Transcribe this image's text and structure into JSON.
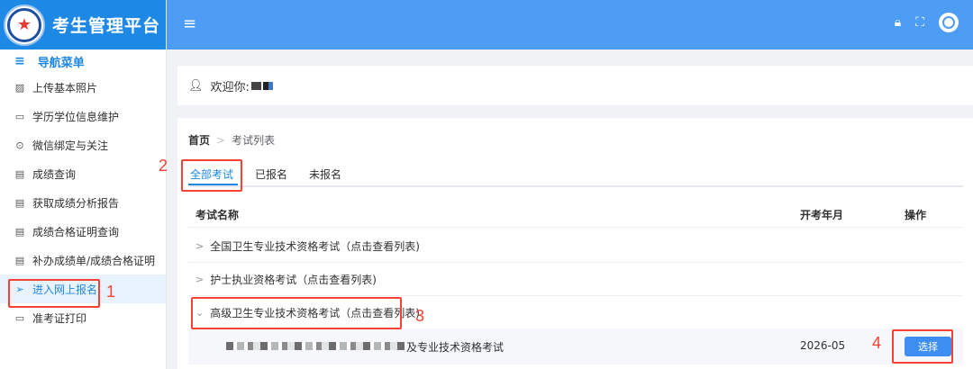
{
  "app": {
    "title": "考生管理平台"
  },
  "topbar": {
    "menu_icon": "hamburger-icon",
    "icons": [
      "lock-icon",
      "fullscreen-icon",
      "user-avatar-icon"
    ]
  },
  "sidebar": {
    "header": "导航菜单",
    "items": [
      {
        "label": "上传基本照片",
        "icon": "image-icon"
      },
      {
        "label": "学历学位信息维护",
        "icon": "book-icon"
      },
      {
        "label": "微信绑定与关注",
        "icon": "wechat-icon"
      },
      {
        "label": "成绩查询",
        "icon": "document-icon"
      },
      {
        "label": "获取成绩分析报告",
        "icon": "report-icon"
      },
      {
        "label": "成绩合格证明查询",
        "icon": "document-icon"
      },
      {
        "label": "补办成绩单/成绩合格证明",
        "icon": "document-icon"
      },
      {
        "label": "进入网上报名",
        "icon": "send-icon",
        "active": true
      },
      {
        "label": "准考证打印",
        "icon": "card-icon"
      }
    ]
  },
  "welcome": {
    "text": "欢迎你:"
  },
  "breadcrumb": {
    "home": "首页",
    "separator": ">",
    "current": "考试列表"
  },
  "tabs": [
    {
      "label": "全部考试",
      "active": true
    },
    {
      "label": "已报名"
    },
    {
      "label": "未报名"
    }
  ],
  "table": {
    "columns": [
      "考试名称",
      "开考年月",
      "操作"
    ],
    "rows": [
      {
        "name": "全国卫生专业技术资格考试（点击查看列表)",
        "expanded": false
      },
      {
        "name": "护士执业资格考试（点击查看列表)",
        "expanded": false
      },
      {
        "name": "高级卫生专业技术资格考试（点击查看列表)",
        "expanded": true
      }
    ],
    "sub_row": {
      "name_suffix": "及专业技术资格考试",
      "date": "2026-05",
      "button": "选择"
    }
  },
  "annotations": [
    "1",
    "2",
    "3",
    "4"
  ],
  "colors": {
    "primary": "#1e88e5",
    "topbar": "#4d9df5",
    "highlight": "#f44336"
  }
}
